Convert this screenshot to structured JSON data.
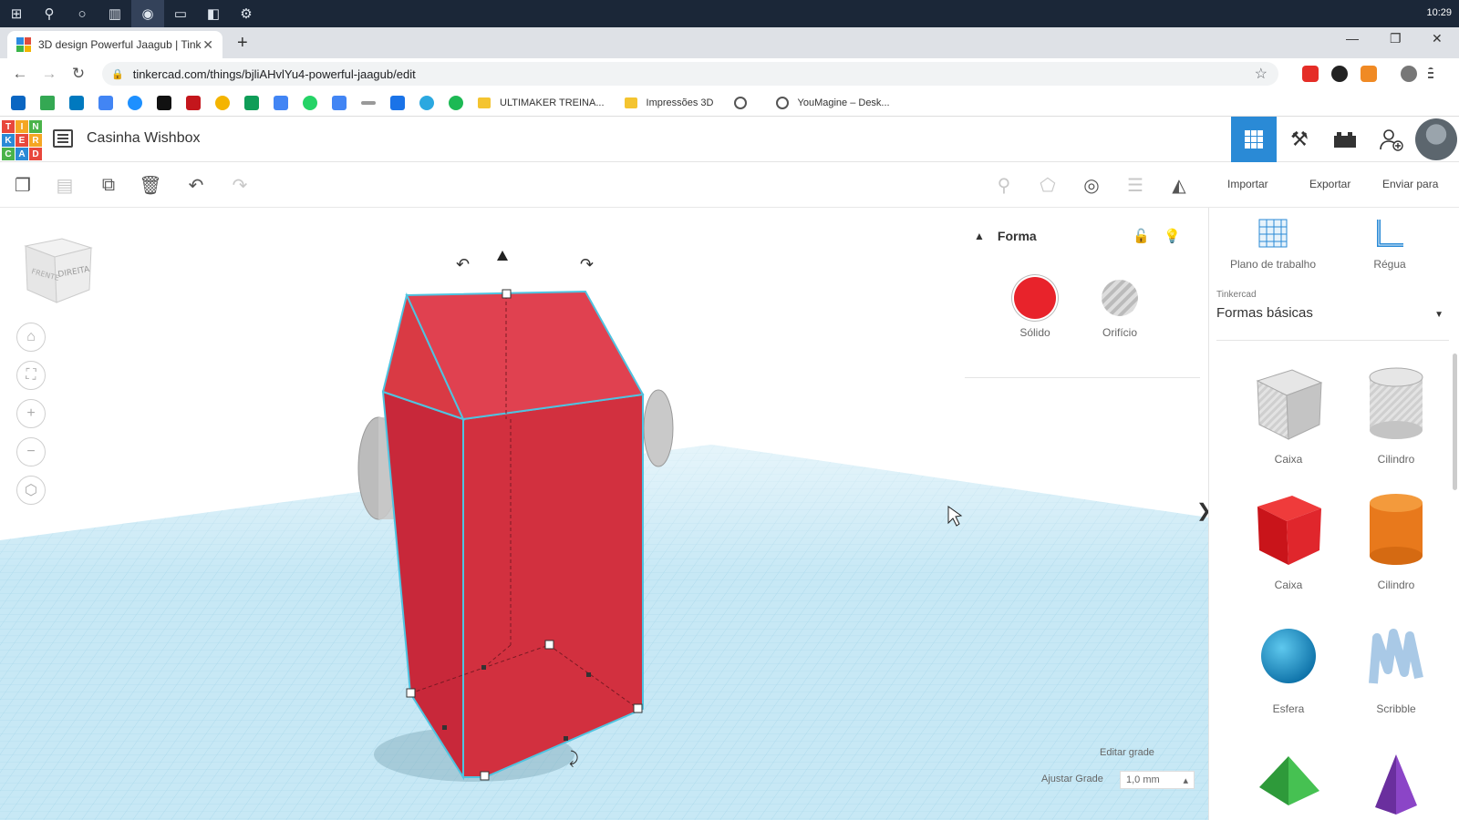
{
  "taskbar": {
    "clock": "10:29"
  },
  "browser": {
    "tab_title": "3D design Powerful Jaagub | Tink",
    "tab_close": "✕",
    "new_tab": "+",
    "url": "tinkercad.com/things/bjliAHvlYu4-powerful-jaagub/edit",
    "bookmarks": [
      {
        "label": "ULTIMAKER TREINA...",
        "icon": "folder-icon"
      },
      {
        "label": "Impressões 3D",
        "icon": "folder-icon"
      },
      {
        "label": "YouMagine – Desk...",
        "icon": "globe-icon"
      }
    ]
  },
  "app": {
    "logo_letters": [
      "T",
      "I",
      "N",
      "K",
      "E",
      "R",
      "C",
      "A",
      "D"
    ],
    "design_name": "Casinha Wishbox"
  },
  "toolbar": {
    "import_label": "Importar",
    "export_label": "Exportar",
    "send_label": "Enviar para"
  },
  "viewcube": {
    "front": "FRENTE",
    "right": "DIREITA"
  },
  "shape_panel": {
    "title": "Forma",
    "solid_label": "Sólido",
    "hole_label": "Orifício",
    "solid_color": "#e8232b"
  },
  "grid": {
    "edit_label": "Editar grade",
    "snap_label": "Ajustar Grade",
    "snap_value": "1,0 mm"
  },
  "sidebar": {
    "workplane_label": "Plano de trabalho",
    "ruler_label": "Régua",
    "library_category": "Tinkercad",
    "library_value": "Formas básicas",
    "shapes": [
      {
        "label": "Caixa",
        "icon": "box-hole-icon"
      },
      {
        "label": "Cilindro",
        "icon": "cylinder-hole-icon"
      },
      {
        "label": "Caixa",
        "icon": "box-icon"
      },
      {
        "label": "Cilindro",
        "icon": "cylinder-icon"
      },
      {
        "label": "Esfera",
        "icon": "sphere-icon"
      },
      {
        "label": "Scribble",
        "icon": "scribble-icon"
      }
    ]
  },
  "colors": {
    "accent": "#2a8ad6",
    "model_red": "#d42d3b",
    "grid": "#bfe4f2"
  }
}
